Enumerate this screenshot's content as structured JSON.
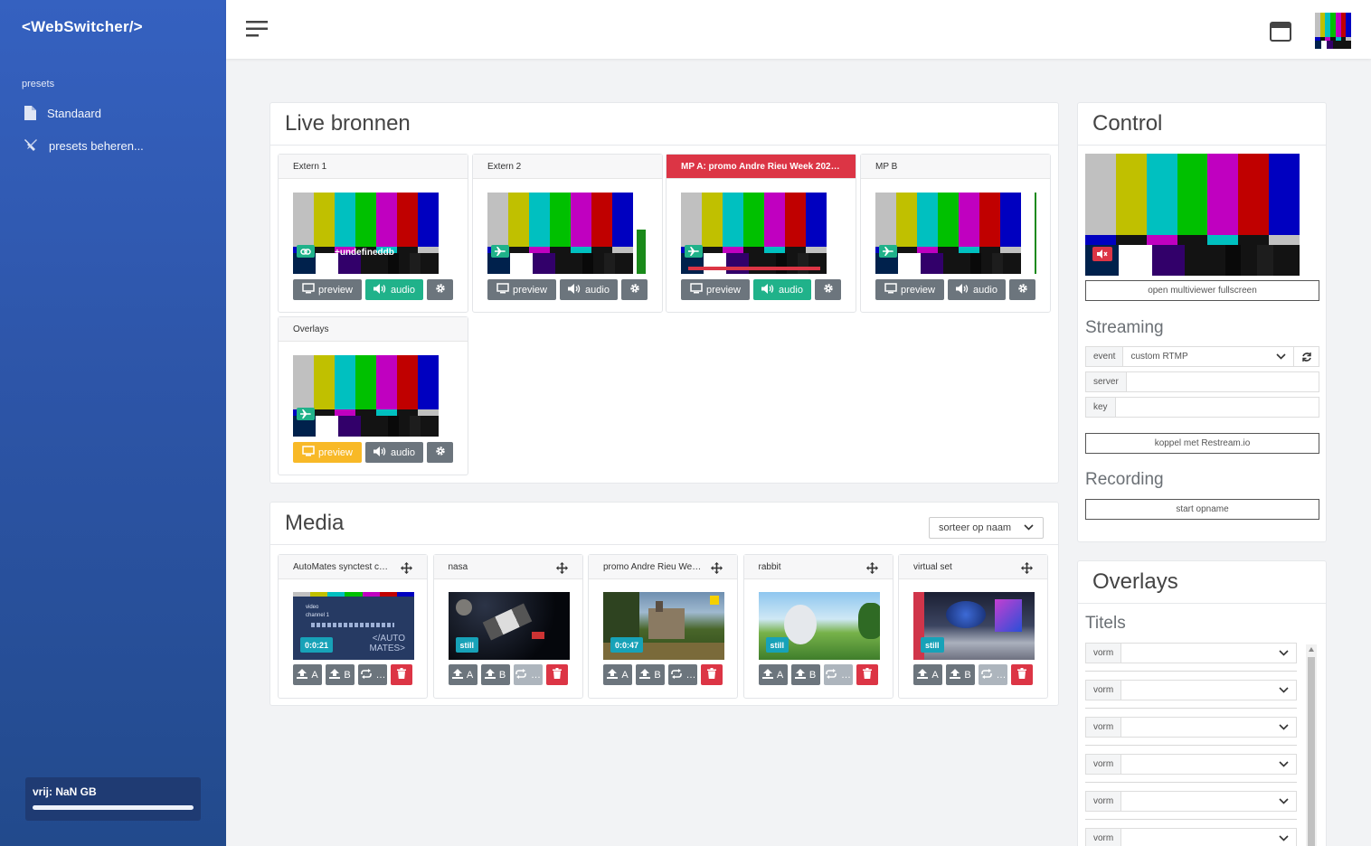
{
  "app": {
    "brand": "<WebSwitcher/>"
  },
  "sidebar": {
    "heading": "presets",
    "items": [
      {
        "label": "Standaard",
        "icon": "file-icon"
      },
      {
        "label": "presets beheren...",
        "icon": "tools-icon"
      }
    ],
    "disk": {
      "label": "vrij: NaN GB",
      "fill_fraction": 1.0
    }
  },
  "topbar": {
    "icons": [
      "hamburger-menu-icon",
      "window-icon",
      "user-avatar"
    ]
  },
  "live": {
    "title": "Live bronnen",
    "cards": [
      {
        "name": "Extern 1",
        "overlay_text": "+undefineddb",
        "badge": "link-icon",
        "preview": "preview",
        "audio": "audio",
        "preview_state": "gray",
        "audio_state": "green"
      },
      {
        "name": "Extern 2",
        "badge": "plane-icon",
        "preview": "preview",
        "audio": "audio",
        "preview_state": "gray",
        "audio_state": "gray",
        "audio_level": 0.55
      },
      {
        "name": "MP A: promo Andre Rieu Week 202…",
        "badge": "plane-icon",
        "preview": "preview",
        "audio": "audio",
        "preview_state": "gray",
        "audio_state": "green",
        "active": true
      },
      {
        "name": "MP B",
        "badge": "plane-icon",
        "preview": "preview",
        "audio": "audio",
        "preview_state": "gray",
        "audio_state": "gray",
        "audio_level": 1.0
      },
      {
        "name": "Overlays",
        "badge": "plane-icon",
        "preview": "preview",
        "audio": "audio",
        "preview_state": "yellow",
        "audio_state": "gray"
      }
    ]
  },
  "control": {
    "title": "Control",
    "multiviewer_button": "open multiviewer fullscreen",
    "streaming": {
      "label": "Streaming",
      "event_label": "event",
      "event_value": "custom RTMP",
      "server_label": "server",
      "key_label": "key",
      "restream_button": "koppel met Restream.io"
    },
    "recording": {
      "label": "Recording",
      "button": "start opname"
    }
  },
  "overlays": {
    "title": "Overlays",
    "section": "Titels",
    "rows": [
      {
        "label": "vorm"
      },
      {
        "label": "vorm"
      },
      {
        "label": "vorm"
      },
      {
        "label": "vorm"
      },
      {
        "label": "vorm"
      },
      {
        "label": "vorm"
      }
    ]
  },
  "media": {
    "title": "Media",
    "sort_label": "sorteer op naam",
    "items": [
      {
        "name": "AutoMates synctest c…",
        "badge": "0:0:21",
        "thumb_text_1": "video",
        "thumb_text_2": "channel 1",
        "logo_1": "</AUTO",
        "logo_2": "MATES>",
        "loop_state": "gray"
      },
      {
        "name": "nasa",
        "badge": "still",
        "loop_state": "light"
      },
      {
        "name": "promo Andre Rieu We…",
        "badge": "0:0:47",
        "loop_state": "gray"
      },
      {
        "name": "rabbit",
        "badge": "still",
        "loop_state": "light"
      },
      {
        "name": "virtual set",
        "badge": "still",
        "loop_state": "light"
      }
    ],
    "btn_a": "A",
    "btn_b": "B",
    "btn_more": "…"
  },
  "colors": {
    "sidebar": "#2d55a8",
    "green": "#20b28a",
    "red": "#dc3545",
    "yellow": "#f8b927",
    "gray": "#6c757d",
    "teal": "#17a2b8",
    "bars": [
      "#c0c0c0",
      "#c0c000",
      "#00c0c0",
      "#00c000",
      "#c000c0",
      "#c00000",
      "#0000c0"
    ],
    "mid_bars": [
      "#0000c0",
      "#131313",
      "#c000c0",
      "#131313",
      "#00c0c0",
      "#131313",
      "#c0c0c0"
    ],
    "bot_bars": [
      "#00214c",
      "#ffffff",
      "#32006a",
      "#131313",
      "#131313",
      "#131313"
    ]
  }
}
